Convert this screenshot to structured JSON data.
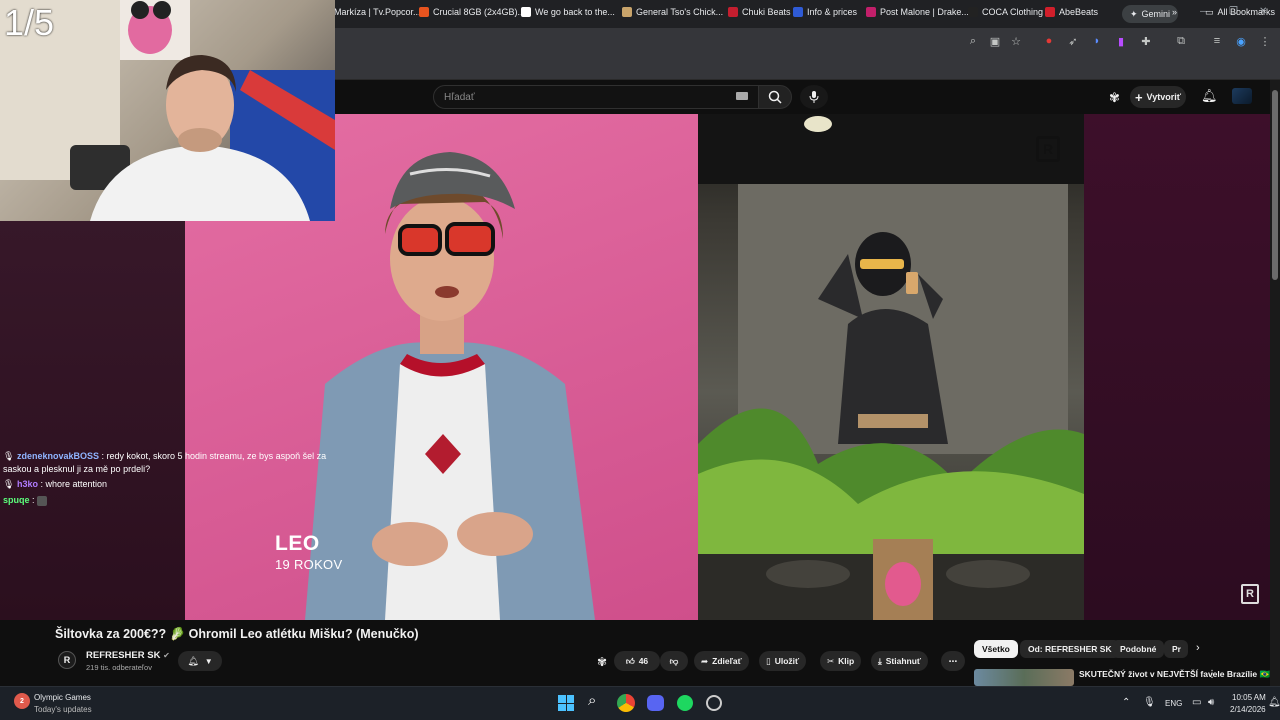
{
  "browser": {
    "gemini_label": "Gemini",
    "bookmarks": [
      {
        "label": "Markíza | Tv.Popcor...",
        "color": "#3a3a3a"
      },
      {
        "label": "Crucial 8GB (2x4GB)...",
        "color": "#e8541f"
      },
      {
        "label": "We go back to the...",
        "color": "#ffffff"
      },
      {
        "label": "General Tso's Chick...",
        "color": "#c9a46b"
      },
      {
        "label": "Chuki Beats",
        "color": "#c41e2f"
      },
      {
        "label": "Info & prices",
        "color": "#2f5bd6"
      },
      {
        "label": "Post Malone | Drake...",
        "color": "#c21f6a"
      },
      {
        "label": "COCA Clothing",
        "color": "#222222"
      },
      {
        "label": "AbeBeats",
        "color": "#d11f2b"
      }
    ],
    "all_bookmarks": "All Bookmarks"
  },
  "youtube": {
    "search_placeholder": "Hľadať",
    "create_label": "Vytvoriť"
  },
  "stream": {
    "counter": "1/5",
    "chat": [
      {
        "user": "zdeneknovakBOSS",
        "user_color": "#8fb4ff",
        "text": " : redy kokot, skoro 5 hodin streamu, ze bys aspoň šel za saskou a plesknul ji za mě po prdeli?"
      },
      {
        "user": "h3ko",
        "user_color": "#b07cff",
        "text": " : whore attention"
      },
      {
        "user": "spuqe",
        "user_color": "#5cff7c",
        "text": " :"
      }
    ]
  },
  "video": {
    "caption_name": "LEO",
    "caption_age": "19 ROKOV",
    "title": "Šiltovka za 200€?? 🥬 Ohromil Leo atlétku Mišku? (Menučko)",
    "channel_name": "REFRESHER SK",
    "channel_subs": "219 tis. odberateľov",
    "likes": "46",
    "actions": {
      "share": "Zdieľať",
      "save": "Uložiť",
      "clip": "Klip",
      "download": "Stiahnuť"
    }
  },
  "recommendations": {
    "chips": [
      "Všetko",
      "Od: REFRESHER SK",
      "Podobné",
      "Pr"
    ],
    "first_title": "SKUTEČNÝ život v NEJVĚTŠÍ favele Brazílie 🇧🇷"
  },
  "taskbar": {
    "news_title": "Olympic Games",
    "news_subtitle": "Today's updates",
    "badge": "2",
    "lang": "ENG",
    "time": "10:05 AM",
    "date": "2/14/2026"
  }
}
